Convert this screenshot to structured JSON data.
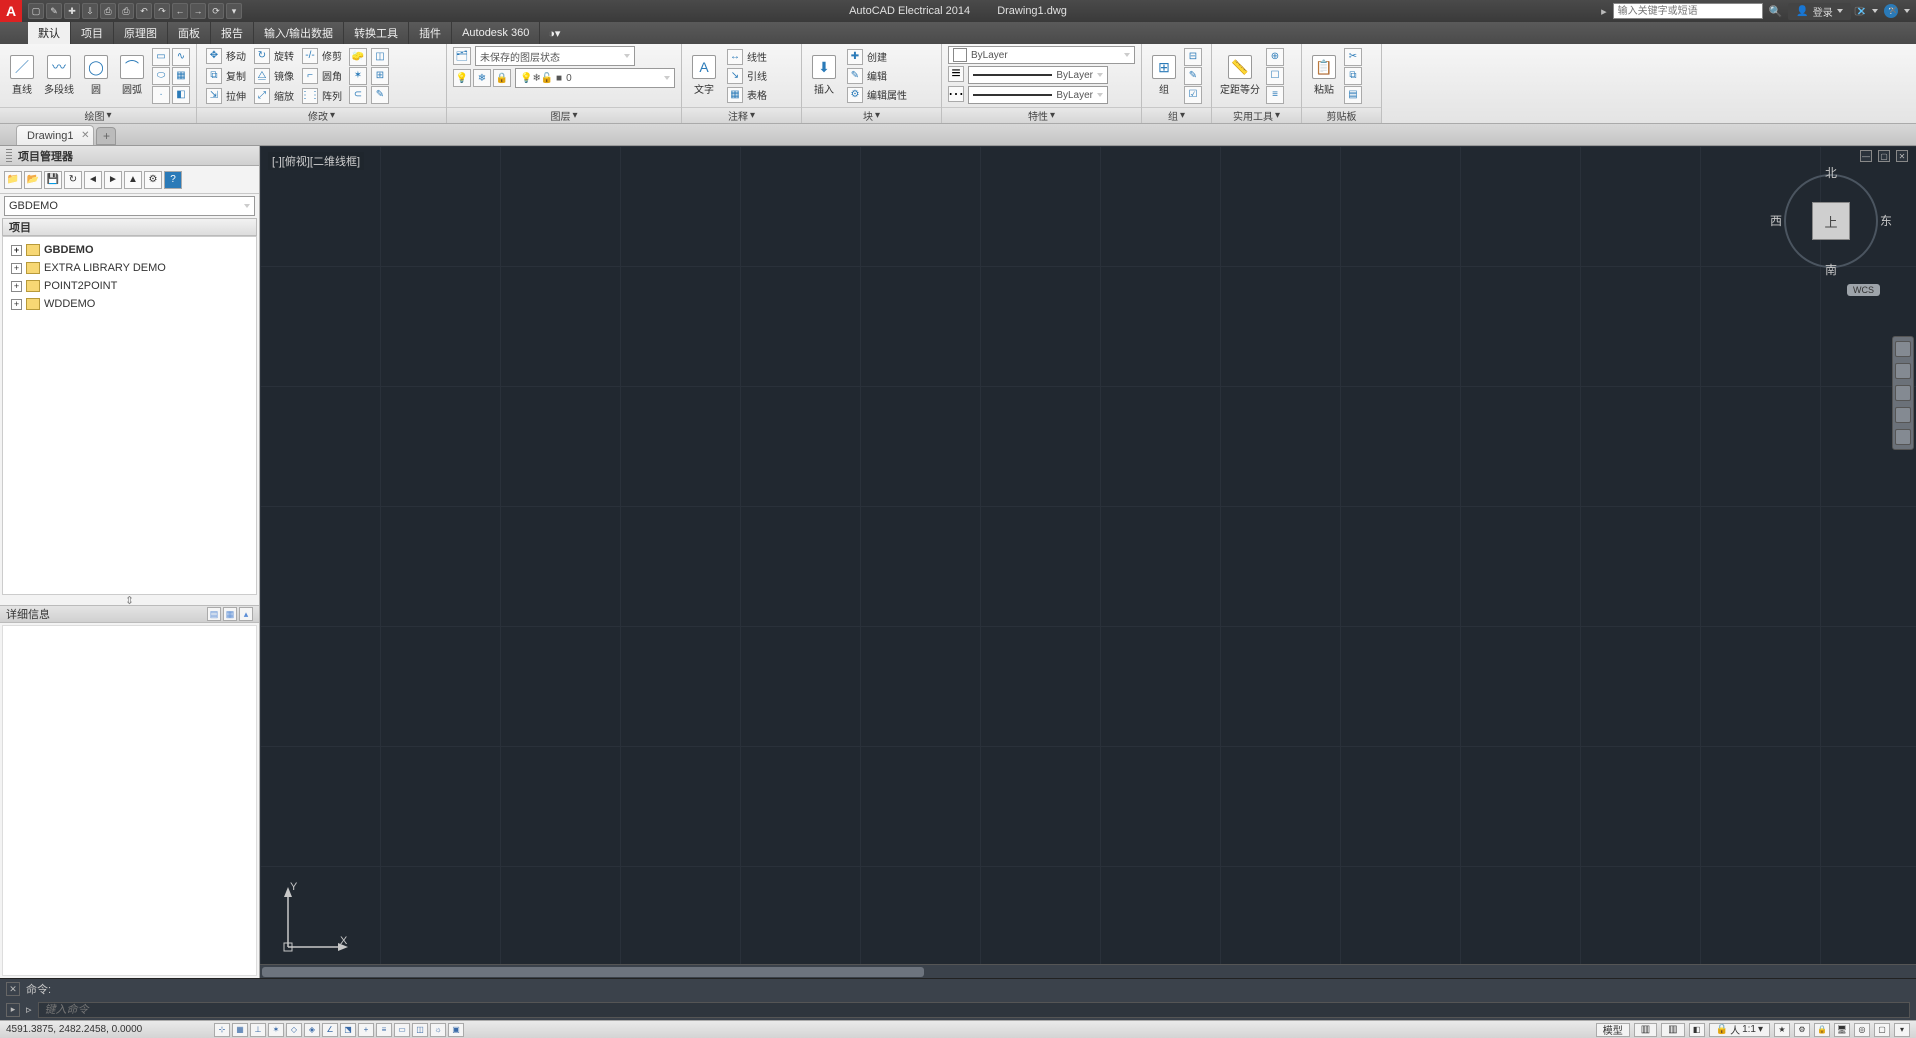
{
  "title": {
    "app": "AutoCAD Electrical 2014",
    "file": "Drawing1.dwg"
  },
  "search_placeholder": "输入关键字或短语",
  "login_label": "登录",
  "menu_tabs": [
    "默认",
    "项目",
    "原理图",
    "面板",
    "报告",
    "输入/输出数据",
    "转换工具",
    "插件",
    "Autodesk 360"
  ],
  "ribbon": {
    "draw": {
      "title": "绘图",
      "btns": [
        "直线",
        "多段线",
        "圆",
        "圆弧"
      ]
    },
    "modify": {
      "title": "修改",
      "r1": [
        "移动",
        "旋转",
        "修剪"
      ],
      "r2": [
        "复制",
        "镜像",
        "圆角"
      ],
      "r3": [
        "拉伸",
        "缩放",
        "阵列"
      ]
    },
    "layer": {
      "title": "图层",
      "state": "未保存的图层状态",
      "combo": "0"
    },
    "annot": {
      "title": "注释",
      "big": "文字",
      "rows": [
        "线性",
        "引线",
        "表格"
      ]
    },
    "block": {
      "title": "块",
      "big": "插入",
      "rows": [
        "创建",
        "编辑",
        "编辑属性"
      ]
    },
    "props": {
      "title": "特性",
      "dd1": "ByLayer",
      "dd2": "ByLayer",
      "dd3": "ByLayer"
    },
    "group": {
      "title": "组",
      "big": "组"
    },
    "util": {
      "title": "实用工具",
      "big": "定距等分"
    },
    "clip": {
      "title": "剪贴板",
      "big": "粘贴"
    }
  },
  "filetabs": [
    "Drawing1"
  ],
  "pm": {
    "title": "项目管理器",
    "combo": "GBDEMO",
    "header": "项目",
    "items": [
      "GBDEMO",
      "EXTRA LIBRARY DEMO",
      "POINT2POINT",
      "WDDEMO"
    ],
    "details": "详细信息"
  },
  "viewport": {
    "label": "[-][俯视][二维线框]",
    "face": "上",
    "n": "北",
    "s": "南",
    "e": "东",
    "w": "西",
    "wcs": "WCS",
    "ucs_y": "Y",
    "ucs_x": "X"
  },
  "cmd": {
    "label": "命令:",
    "placeholder": "键入命令"
  },
  "status": {
    "coords": "4591.3875, 2482.2458, 0.0000",
    "model": "模型",
    "scale": "1:1"
  }
}
